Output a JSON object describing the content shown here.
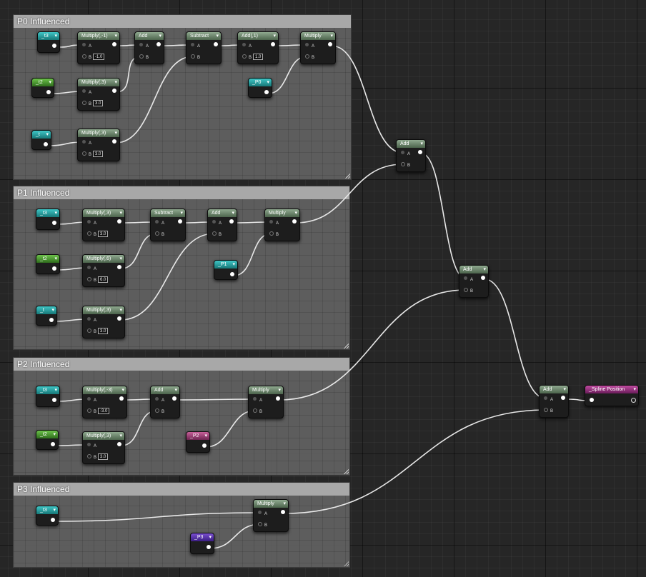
{
  "comments": [
    {
      "id": "p0",
      "title": "P0 Influenced"
    },
    {
      "id": "p1",
      "title": "P1 Influenced"
    },
    {
      "id": "p2",
      "title": "P2 Influenced"
    },
    {
      "id": "p3",
      "title": "P3 Influenced"
    }
  ],
  "nodes": {
    "p0_t3": {
      "title": "_t3"
    },
    "p0_t2": {
      "title": "_t2"
    },
    "p0_t": {
      "title": "_t"
    },
    "p0_P0": {
      "title": "_P0"
    },
    "p0_mul_n1": {
      "title": "Multiply(,-1)",
      "pins": {
        "a": "A",
        "b": "B",
        "b_val": "-1.0"
      }
    },
    "p0_mul_3a": {
      "title": "Multiply(,3)",
      "pins": {
        "a": "A",
        "b": "B",
        "b_val": "3.0"
      }
    },
    "p0_mul_3b": {
      "title": "Multiply(,3)",
      "pins": {
        "a": "A",
        "b": "B",
        "b_val": "3.0"
      }
    },
    "p0_add": {
      "title": "Add",
      "pins": {
        "a": "A",
        "b": "B"
      }
    },
    "p0_sub": {
      "title": "Subtract",
      "pins": {
        "a": "A",
        "b": "B"
      }
    },
    "p0_add1": {
      "title": "Add(,1)",
      "pins": {
        "a": "A",
        "b": "B",
        "b_val": "1.0"
      }
    },
    "p0_mul": {
      "title": "Multiply",
      "pins": {
        "a": "A",
        "b": "B"
      }
    },
    "p1_t3": {
      "title": "_t3"
    },
    "p1_t2": {
      "title": "_t2"
    },
    "p1_t": {
      "title": "_t"
    },
    "p1_P1": {
      "title": "_P1"
    },
    "p1_mul_3": {
      "title": "Multiply(,3)",
      "pins": {
        "a": "A",
        "b": "B",
        "b_val": "3.0"
      }
    },
    "p1_mul_6": {
      "title": "Multiply(,6)",
      "pins": {
        "a": "A",
        "b": "B",
        "b_val": "6.0"
      }
    },
    "p1_mul_3b": {
      "title": "Multiply(,3)",
      "pins": {
        "a": "A",
        "b": "B",
        "b_val": "3.0"
      }
    },
    "p1_sub": {
      "title": "Subtract",
      "pins": {
        "a": "A",
        "b": "B"
      }
    },
    "p1_add": {
      "title": "Add",
      "pins": {
        "a": "A",
        "b": "B"
      }
    },
    "p1_mul": {
      "title": "Multiply",
      "pins": {
        "a": "A",
        "b": "B"
      }
    },
    "p2_t3": {
      "title": "_t3"
    },
    "p2_t2": {
      "title": "_t2"
    },
    "p2_P2": {
      "title": "_P2"
    },
    "p2_mul_n3": {
      "title": "Multiply(,-3)",
      "pins": {
        "a": "A",
        "b": "B",
        "b_val": "-3.0"
      }
    },
    "p2_mul_3": {
      "title": "Multiply(,3)",
      "pins": {
        "a": "A",
        "b": "B",
        "b_val": "3.0"
      }
    },
    "p2_add": {
      "title": "Add",
      "pins": {
        "a": "A",
        "b": "B"
      }
    },
    "p2_mul": {
      "title": "Multiply",
      "pins": {
        "a": "A",
        "b": "B"
      }
    },
    "p3_t3": {
      "title": "_t3"
    },
    "p3_P3": {
      "title": "_P3"
    },
    "p3_mul": {
      "title": "Multiply",
      "pins": {
        "a": "A",
        "b": "B"
      }
    },
    "sum1": {
      "title": "Add",
      "pins": {
        "a": "A",
        "b": "B"
      }
    },
    "sum2": {
      "title": "Add",
      "pins": {
        "a": "A",
        "b": "B"
      }
    },
    "sum3": {
      "title": "Add",
      "pins": {
        "a": "A",
        "b": "B"
      }
    },
    "spline": {
      "title": "_Spline Position"
    }
  },
  "colors": {
    "wire": "#e8e8e8",
    "canvas": "#262626",
    "comment_bar": "#a8a8a8"
  }
}
